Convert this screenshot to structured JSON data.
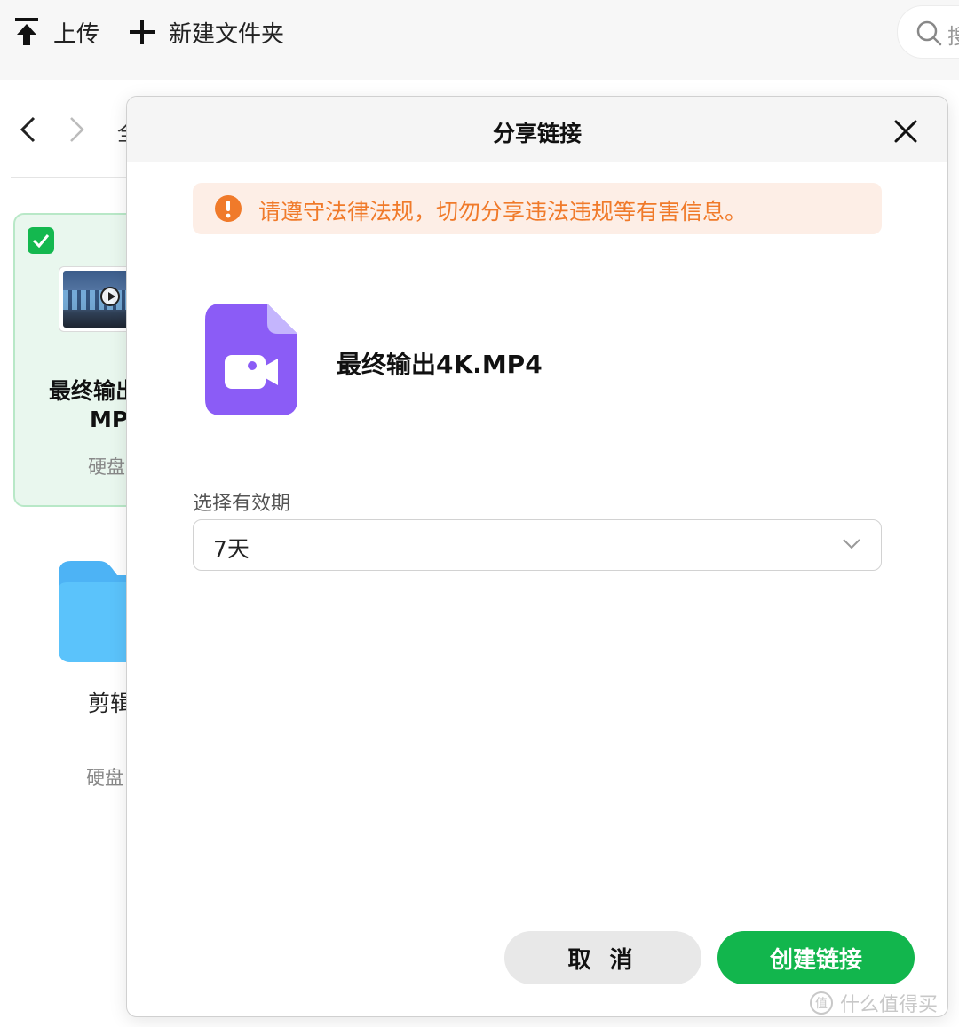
{
  "toolbar": {
    "upload_label": "上传",
    "new_folder_label": "新建文件夹",
    "search_placeholder": "搜"
  },
  "nav": {
    "breadcrumb": "全"
  },
  "files": [
    {
      "name_line1": "最终输出",
      "name_line2": "MP",
      "location": "硬盘",
      "selected": true,
      "type_icon": "video-thumbnail"
    },
    {
      "name": "剪辑",
      "location": "硬盘",
      "type_icon": "folder-icon"
    }
  ],
  "share_dialog": {
    "title": "分享链接",
    "warning": "请遵守法律法规，切勿分享违法违规等有害信息。",
    "file_name": "最终输出4K.MP4",
    "validity_label": "选择有效期",
    "validity_value": "7天",
    "cancel_label": "取 消",
    "create_label": "创建链接"
  },
  "watermark": {
    "logo_text": "值",
    "text": "什么值得买"
  },
  "colors": {
    "primary_green": "#12b64d",
    "warning_orange": "#f07a2a",
    "warning_bg": "#fdeee6",
    "file_icon_purple": "#8b5cf6"
  }
}
